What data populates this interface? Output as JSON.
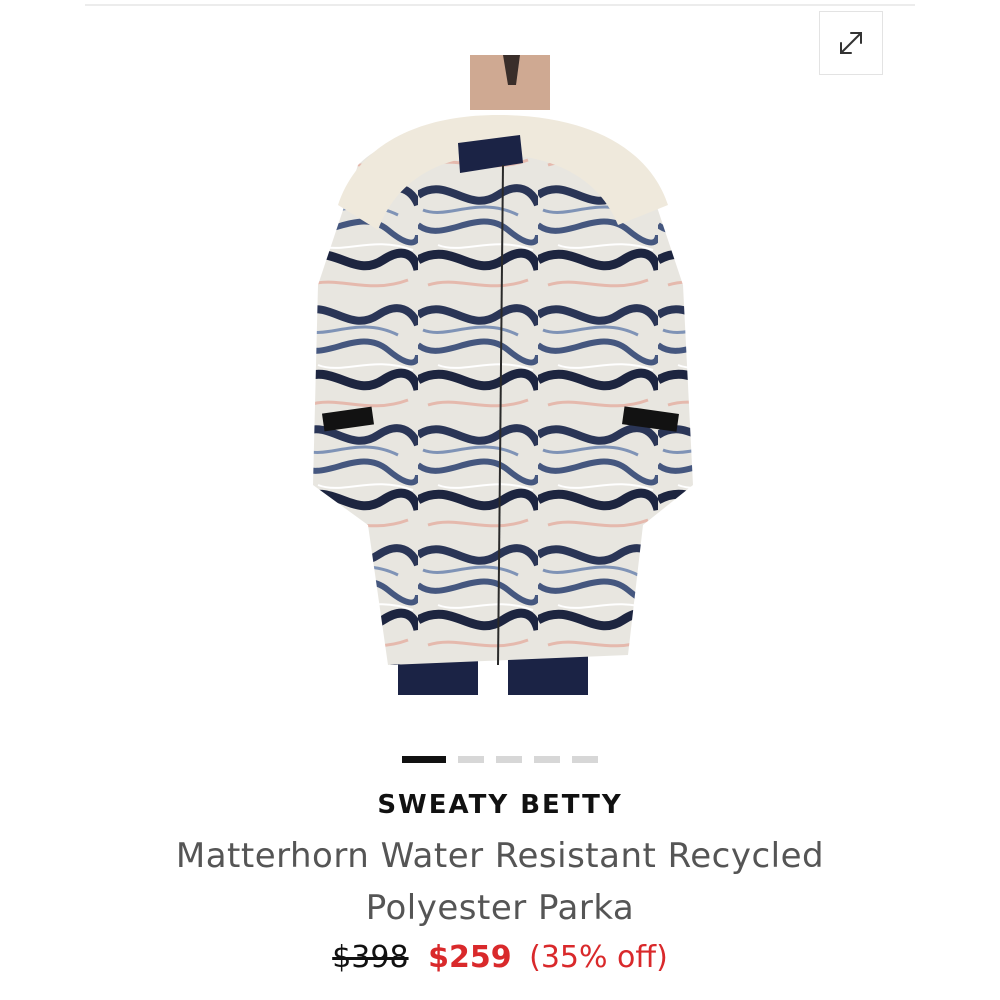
{
  "product": {
    "brand": "SWEATY BETTY",
    "title": "Matterhorn Water Resistant Recycled Polyester Parka",
    "price_original": "$398",
    "price_sale": "$259",
    "discount": "(35% off)"
  },
  "gallery": {
    "expand_icon": "expand-arrows-icon",
    "image_count": 5,
    "active_index": 0
  },
  "colors": {
    "sale": "#d9292b",
    "text": "#111111",
    "title": "#555555",
    "dot_active": "#111111",
    "dot_inactive": "#d7d7d7"
  }
}
